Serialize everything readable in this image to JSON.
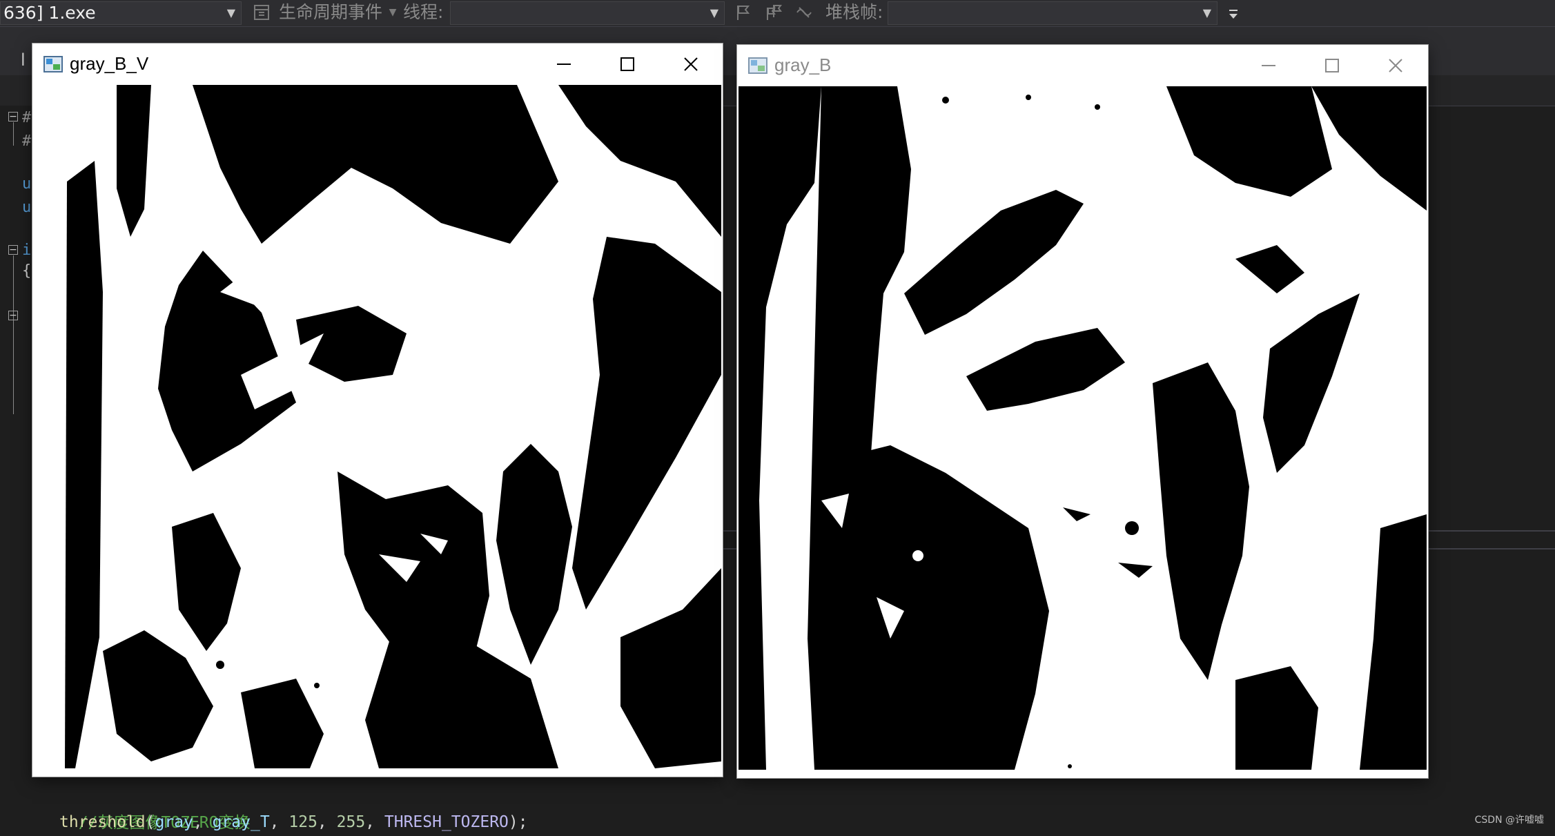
{
  "toolbar": {
    "process_combo": "636] 1.exe",
    "lifecycle_label": "生命周期事件",
    "thread_label": "线程:",
    "stack_label": "堆栈帧:"
  },
  "editor": {
    "tab_label": "l",
    "gutter_chars": [
      "#",
      "#",
      "u",
      "u",
      "i",
      "{"
    ],
    "code_lines": [
      {
        "comment": "//灰度图像TOZERO变换"
      },
      {
        "fn": "threshold",
        "open": "(",
        "arg1": "gray",
        "sep1": ", ",
        "arg2": "gray_T",
        "sep2": ", ",
        "num1": "125",
        "sep3": ", ",
        "num2": "255",
        "sep4": ", ",
        "const": "THRESH_TOZERO",
        "close": ");"
      }
    ]
  },
  "windows": [
    {
      "title": "gray_B_V",
      "active": true
    },
    {
      "title": "gray_B",
      "active": false
    }
  ],
  "watermark": "CSDN @许嘘嘘",
  "colors": {
    "toolbar_bg": "#2d2d30",
    "editor_bg": "#1e1e1e",
    "comment": "#57a64a",
    "function": "#dcdcaa",
    "variable": "#9cdcfe",
    "number": "#b5cea8"
  }
}
